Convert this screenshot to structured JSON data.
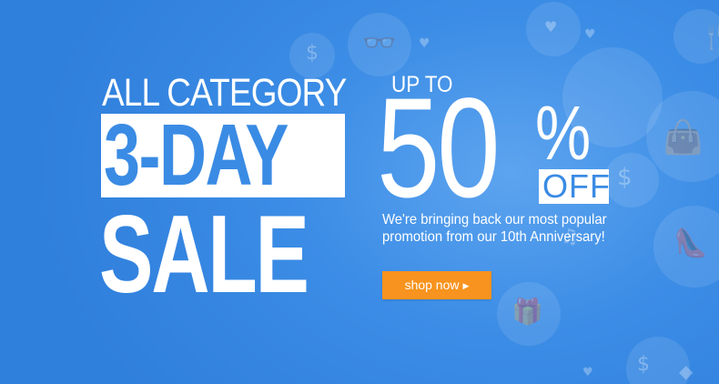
{
  "banner": {
    "headline_line1": "ALL CATEGORY",
    "headline_line2": "3-DAY",
    "headline_line3": "SALE",
    "up_to": "UP TO",
    "discount_number": "50",
    "discount_symbol": "%",
    "off_label": "OFF",
    "promo_line1": "We're bringing back our most popular",
    "promo_line2": "promotion from our 10th Anniversary!",
    "cta_label": "shop now",
    "cta_arrow": "▶"
  },
  "colors": {
    "background": "#3c8de6",
    "accent_blue": "#3a8be4",
    "button_orange": "#f7931e",
    "text_white": "#ffffff"
  },
  "decor_icons": {
    "sunglasses": "sunglasses-icon",
    "dollar": "dollar-icon",
    "heart": "heart-icon",
    "handbag": "handbag-icon",
    "gift": "gift-icon",
    "shoe": "shoe-icon",
    "cutlery": "cutlery-icon",
    "tag": "tag-icon",
    "guitar": "guitar-icon"
  }
}
